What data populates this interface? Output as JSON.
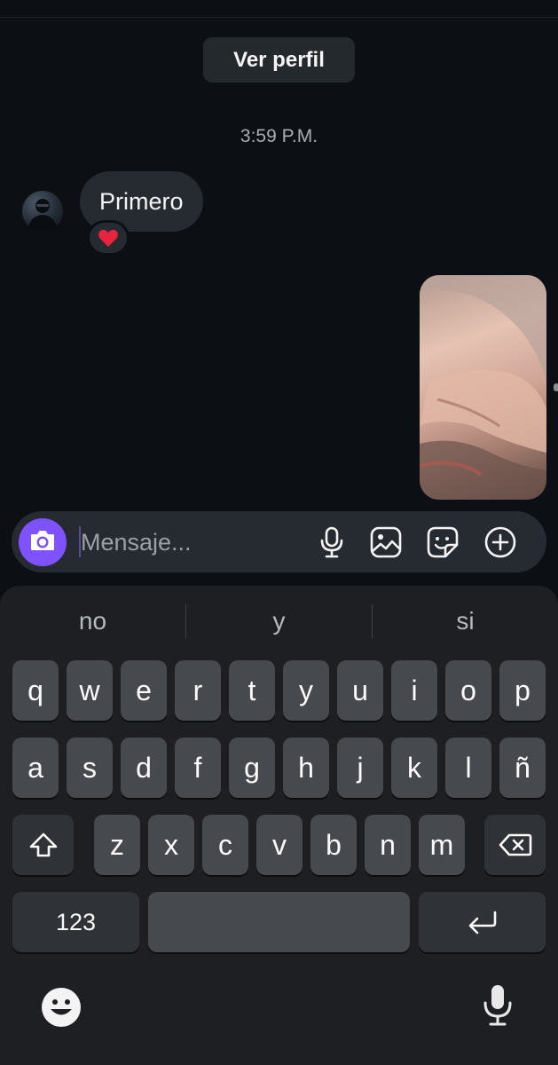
{
  "chat": {
    "view_profile_label": "Ver perfil",
    "timestamp": "3:59 P.M.",
    "messages": [
      {
        "direction": "incoming",
        "text": "Primero",
        "reaction": "❤️"
      }
    ],
    "outgoing_media": {
      "type": "photo"
    }
  },
  "composer": {
    "placeholder": "Mensaje...",
    "value": "",
    "icons": [
      "camera-icon",
      "microphone-icon",
      "gallery-icon",
      "sticker-icon",
      "add-icon"
    ],
    "camera_button_color": "#7f52ff"
  },
  "keyboard": {
    "suggestions": [
      "no",
      "y",
      "si"
    ],
    "rows": [
      [
        "q",
        "w",
        "e",
        "r",
        "t",
        "y",
        "u",
        "i",
        "o",
        "p"
      ],
      [
        "a",
        "s",
        "d",
        "f",
        "g",
        "h",
        "j",
        "k",
        "l",
        "ñ"
      ],
      [
        "z",
        "x",
        "c",
        "v",
        "b",
        "n",
        "m"
      ]
    ],
    "numbers_key_label": "123",
    "special_keys": [
      "shift-icon",
      "backspace-icon",
      "space",
      "return-icon",
      "emoji-icon",
      "voice-input-icon"
    ]
  },
  "colors": {
    "background": "#0c1014",
    "bubble": "#262b31",
    "keyboard": "#1d1f23",
    "key": "#46494d",
    "accent": "#7f52ff"
  }
}
